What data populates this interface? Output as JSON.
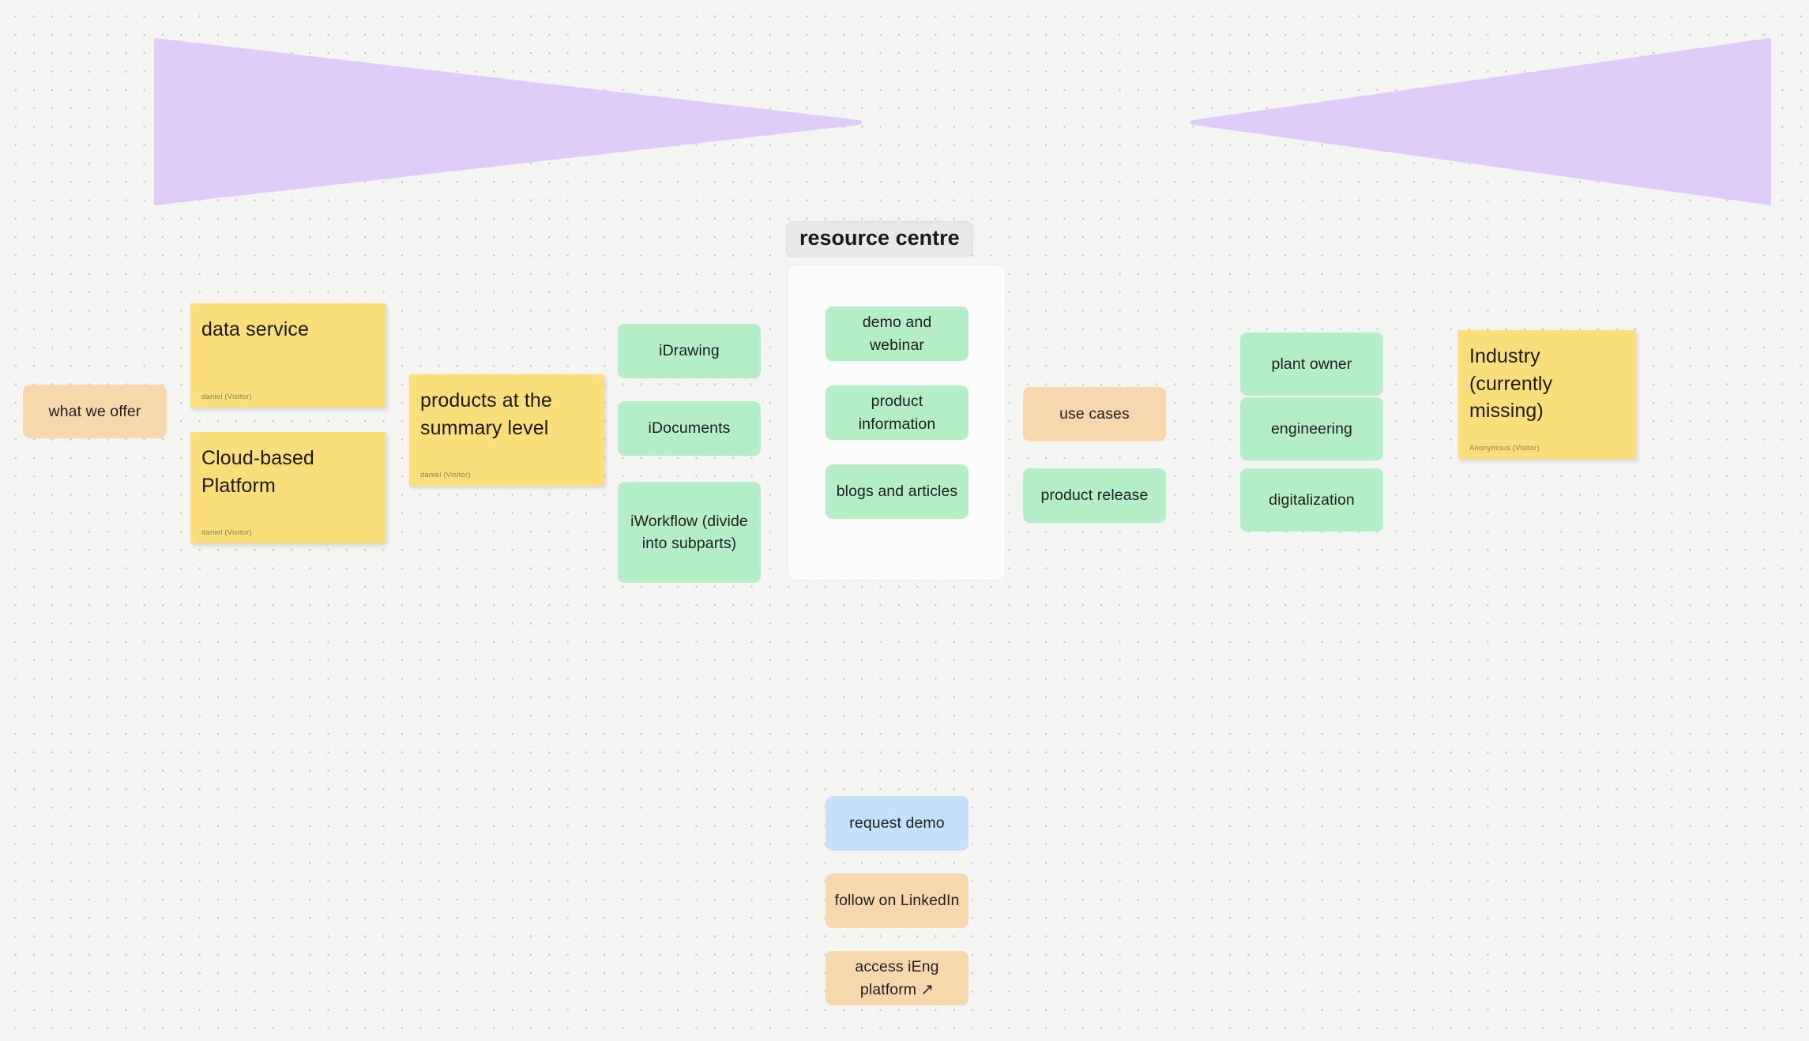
{
  "board": {
    "background_color": "#f4f4f3",
    "dot_color": "#c9c9c9"
  },
  "shapes": {
    "left_wedge": {
      "name": "purple-wedge-left",
      "color": "#dfccf8"
    },
    "right_wedge": {
      "name": "purple-wedge-right",
      "color": "#dfccf8"
    }
  },
  "frame": {
    "title": "resource centre",
    "cards": [
      {
        "label": "demo and webinar",
        "color": "#b3eec6"
      },
      {
        "label": "product information",
        "color": "#b3eec6"
      },
      {
        "label": "blogs and articles",
        "color": "#b3eec6"
      }
    ]
  },
  "sticky_notes": [
    {
      "text": "data service",
      "author": "daniel (Visitor)",
      "color": "#f9de79"
    },
    {
      "text": "Cloud-based Platform",
      "author": "daniel (Visitor)",
      "color": "#f9de79"
    },
    {
      "text": "products at the summary level",
      "author": "daniel (Visitor)",
      "color": "#f9de79"
    },
    {
      "text": "Industry (currently missing)",
      "author": "Anonymous (Visitor)",
      "color": "#f9de79"
    }
  ],
  "cards": {
    "what_we_offer": {
      "label": "what we offer",
      "color": "#f6d8ac"
    },
    "idrawing": {
      "label": "iDrawing",
      "color": "#b3eec6"
    },
    "idocuments": {
      "label": "iDocuments",
      "color": "#b3eec6"
    },
    "iworkflow": {
      "label": "iWorkflow (divide into subparts)",
      "color": "#b3eec6"
    },
    "use_cases": {
      "label": "use cases",
      "color": "#f6d8ac"
    },
    "product_release": {
      "label": "product release",
      "color": "#b3eec6"
    },
    "plant_owner": {
      "label": "plant owner",
      "color": "#b3eec6"
    },
    "engineering": {
      "label": "engineering",
      "color": "#b3eec6"
    },
    "digitalization": {
      "label": "digitalization",
      "color": "#b3eec6"
    },
    "request_demo": {
      "label": "request demo",
      "color": "#c4e0fb"
    },
    "follow_linkedin": {
      "label": "follow on LinkedIn",
      "color": "#f6d8ac"
    },
    "access_platform": {
      "label": "access iEng platform ↗",
      "color": "#f6d8ac"
    }
  }
}
